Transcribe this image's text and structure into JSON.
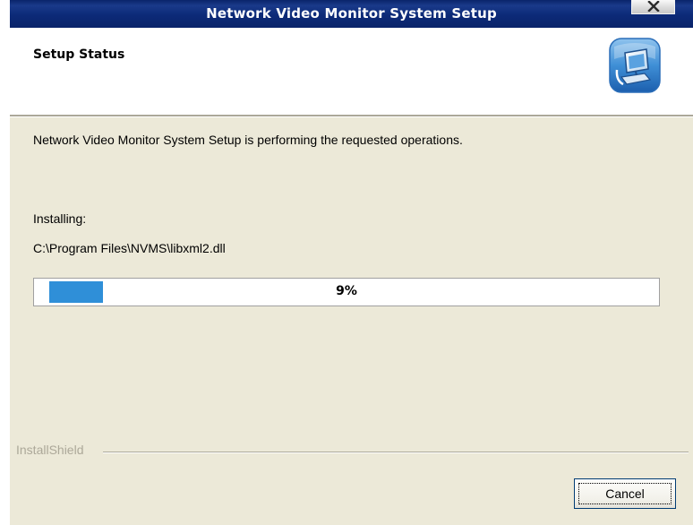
{
  "window": {
    "title": "Network Video Monitor System Setup",
    "close_icon": "close-icon"
  },
  "header": {
    "title": "Setup Status",
    "logo_icon": "computer-setup-icon"
  },
  "body": {
    "status_text": "Network Video Monitor System Setup is performing the requested operations.",
    "installing_label": "Installing:",
    "file_path": "C:\\Program Files\\NVMS\\libxml2.dll",
    "progress": {
      "percent_label": "9%",
      "value": 0.09,
      "fill_color": "#2f8fd8"
    }
  },
  "footer": {
    "brand_label": "InstallShield",
    "cancel_label": "Cancel"
  },
  "colors": {
    "titlebar": "#0a246a",
    "dialog_background": "#ece9d8"
  }
}
